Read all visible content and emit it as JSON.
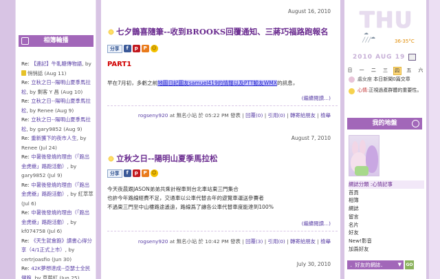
{
  "left": {
    "title": "相簿輪播",
    "items": [
      {
        "pre": "Re: ",
        "link": "【連記】牛軋糖傳物語",
        "by": ", by"
      },
      {
        "lock": true,
        "pre": "",
        "link": "",
        "by": "悄悄話 (Aug 11)"
      },
      {
        "pre": "Re: ",
        "link": "立秋之日--陽明山夏季馬拉松",
        "by": ", by 剩客 Y 昌 (Aug 10)"
      },
      {
        "pre": "Re: ",
        "link": "立秋之日--陽明山夏季馬拉松",
        "by": ", by Renee (Aug 9)"
      },
      {
        "pre": "Re: ",
        "link": "立秋之日--陽明山夏季馬拉松",
        "by": ", by gary9852 (Aug 9)"
      },
      {
        "pre": "Re: ",
        "link": "重新獲下的夜市人生",
        "by": ", by Renee (Jul 24)"
      },
      {
        "pre": "Re: ",
        "link": "中暑後發燒的理由（「跑出金虎爺」路跑活動）",
        "by": ", by gary9852 (Jul 9)"
      },
      {
        "pre": "Re: ",
        "link": "中暑後發燒的理由（「跑出金虎爺」路跑活動）",
        "by": ", by 紅萃萃 (Jul 6)"
      },
      {
        "pre": "Re: ",
        "link": "中暑後發燒的理由（「跑出金虎爺」路跑活動）",
        "by": ", by kf074758 (Jul 6)"
      },
      {
        "pre": "Re: ",
        "link": "《天生就會跑》讀書心得分享（4/1正式上市）",
        "by": ", by certrjoasfio (Jun 30)"
      },
      {
        "pre": "Re: ",
        "link": "42K夢想達成--亞瑟士全民健跑",
        "by": ", by 草莓紅 (Jun 25)"
      }
    ]
  },
  "posts": [
    {
      "date": "August 16, 2010",
      "title": "七夕鵲喜隨筆--收到BROOKS回覆通知、三蔣巧福路跑報名",
      "share": "分享",
      "part": "PART1",
      "text_pre": "早在7月初，多虧之前",
      "text_link": "地圖日記圖友samuel419的情報以及PTT鯨友WMX",
      "text_post": "的訊息，",
      "more": "(繼續閱讀...)",
      "footer_author": "rogseny920",
      "footer_mid": " at 無名小站 於 05:22 PM 發表 | ",
      "footer_links": [
        "回覆(0)",
        "引用(0)",
        "轉寄給朋友",
        "檢舉"
      ]
    },
    {
      "date": "August 7, 2010",
      "title": "立秋之日--陽明山夏季馬拉松",
      "lines": [
        "今天夜晨跟JASON弟弟共乘計程車到台北車站東三門集合",
        "也許今年路線經費不足，交通車以公車代替去年的遊覽車運送參賽者",
        "不過東三門至中山樓路途遙遠，路線爲了讓各公車代替車度能達到100%"
      ],
      "more": "(繼續閱讀...)",
      "footer_author": "rogseny920",
      "footer_mid": " at 無名小站 於 10:42 PM 發表 | ",
      "footer_links": [
        "回覆(3)",
        "引用(0)",
        "轉寄給朋友",
        "檢舉"
      ]
    },
    {
      "date": "July 30, 2010"
    }
  ],
  "right": {
    "day": "THU",
    "temp": "36-35°C",
    "dateline": "2010 AUG 19",
    "week": [
      "日",
      "一",
      "二",
      "三",
      "四",
      "五",
      "六"
    ],
    "week_cur": 4,
    "sign_label": "處女座",
    "sign_text": "本日新聞0篇交章",
    "mood_label": "心情:",
    "mood_text": "正視過產群體的重要性。",
    "base_title": "我的地盤",
    "nav": [
      "網誌分類 :心情記事",
      "首頁",
      "相簿",
      "網誌",
      "留言",
      "名片",
      "好友",
      "New!影音",
      "加爲好友"
    ],
    "friends": "．好友的網誌．",
    "go": "GO"
  }
}
